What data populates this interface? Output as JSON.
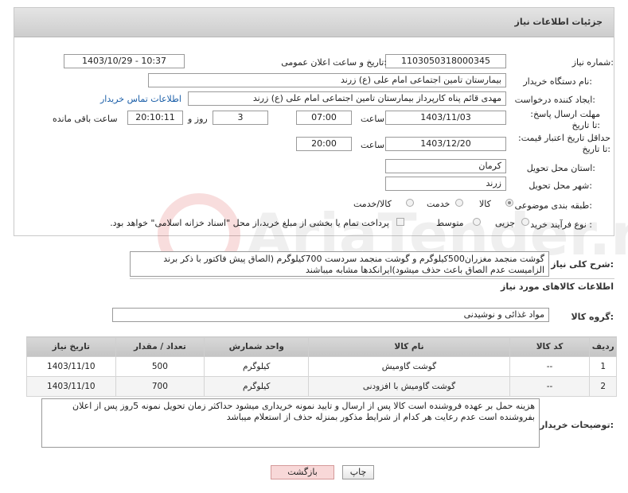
{
  "header": {
    "title": "جزئیات اطلاعات نیاز"
  },
  "fields": {
    "need_number_label": "شماره نیاز:",
    "need_number": "1103050318000345",
    "announce_label": "تاریخ و ساعت اعلان عمومی:",
    "announce_value": "1403/10/29 - 10:37",
    "buyer_org_label": "نام دستگاه خریدار:",
    "buyer_org": "بیمارستان تامین اجتماعی امام علی (ع) زرند",
    "creator_label": "ایجاد کننده درخواست:",
    "creator": "مهدی  قائم پناه  کارپرداز بیمارستان تامین اجتماعی امام علی (ع) زرند",
    "contact_link": "اطلاعات تماس خریدار",
    "reply_deadline_label": "مهلت ارسال پاسخ: تا تاریخ:",
    "reply_date": "1403/11/03",
    "time_word": "ساعت",
    "reply_time": "07:00",
    "days_value": "3",
    "days_and": "روز و",
    "remaining_time": "20:10:11",
    "remaining_label": "ساعت باقی مانده",
    "validity_label": "حداقل تاریخ اعتبار قیمت: تا تاریخ:",
    "validity_date": "1403/12/20",
    "validity_time": "20:00",
    "province_label": "استان محل تحویل:",
    "province": "کرمان",
    "city_label": "شهر محل تحویل:",
    "city": "زرند",
    "category_label": "طبقه بندی موضوعی:",
    "category_options": [
      "کالا",
      "خدمت",
      "کالا/خدمت"
    ],
    "purchase_type_label": "نوع فرآیند خرید :",
    "purchase_options": [
      "جزیی",
      "متوسط"
    ],
    "payment_note": "پرداخت تمام یا بخشی از مبلغ خرید،از محل \"اسناد خزانه اسلامی\" خواهد بود."
  },
  "summary": {
    "label": "شرح کلی نیاز:",
    "text": "گوشت منجمد مغزران500کیلوگرم و گوشت منجمد سردست 700کیلوگرم (الصاق پیش فاکتور با ذکر برند الزامیست عدم الصاق باعث حذف میشود)ایرانکدها مشابه میباشند"
  },
  "goods_section": {
    "title": "اطلاعات کالاهای مورد نیاز",
    "group_label": "گروه کالا:",
    "group_value": "مواد غذائی و نوشیدنی"
  },
  "table": {
    "headers": [
      "ردیف",
      "کد کالا",
      "نام کالا",
      "واحد شمارش",
      "تعداد / مقدار",
      "تاریخ نیاز"
    ],
    "rows": [
      [
        "1",
        "--",
        "گوشت گاومیش",
        "کیلوگرم",
        "500",
        "1403/11/10"
      ],
      [
        "2",
        "--",
        "گوشت گاومیش با افزودنی",
        "کیلوگرم",
        "700",
        "1403/11/10"
      ]
    ]
  },
  "buyer_notes": {
    "label": "توضیحات خریدار:",
    "text": "هزینه حمل بر عهده فروشنده است کالا پس از ارسال و تایید نمونه خریداری میشود حداکثر زمان تحویل نمونه 5روز پس از اعلان بفروشنده است عدم رعایت هر کدام از شرایط مذکور بمنزله حذف از استعلام میباشد"
  },
  "buttons": {
    "print": "چاپ",
    "back": "بازگشت"
  },
  "colors": {
    "link": "#1a5ea8",
    "back_button_bg": "#f8d8d8",
    "header_bg": "#d6d6d6"
  }
}
